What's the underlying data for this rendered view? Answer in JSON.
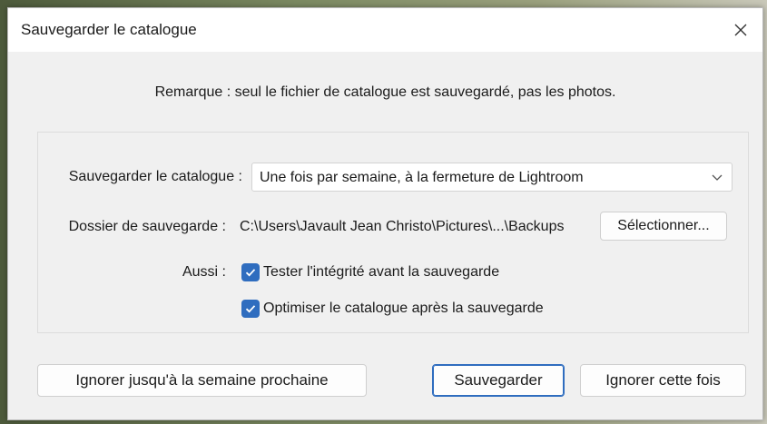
{
  "dialog": {
    "title": "Sauvegarder le catalogue",
    "note": "Remarque : seul le fichier de catalogue est sauvegardé, pas les photos."
  },
  "catalog_backup": {
    "label": "Sauvegarder le catalogue :",
    "selected_option": "Une fois par semaine, à la fermeture de Lightroom"
  },
  "backup_folder": {
    "label": "Dossier de sauvegarde :",
    "path": "C:\\Users\\Javault Jean Christo\\Pictures\\...\\Backups",
    "choose_label": "Sélectionner..."
  },
  "also": {
    "label": "Aussi :",
    "options": [
      {
        "label": "Tester l'intégrité avant la sauvegarde",
        "checked": true
      },
      {
        "label": "Optimiser le catalogue après la sauvegarde",
        "checked": true
      }
    ]
  },
  "buttons": {
    "skip_until_next_week": "Ignorer jusqu'à la semaine prochaine",
    "backup": "Sauvegarder",
    "skip_this_time": "Ignorer cette fois"
  },
  "colors": {
    "accent": "#2f6dbf",
    "dialog_bg": "#f0f0f0",
    "titlebar_bg": "#ffffff"
  },
  "icons": {
    "close": "close-icon",
    "dropdown": "chevron-down-icon",
    "checkbox": "check-icon"
  }
}
